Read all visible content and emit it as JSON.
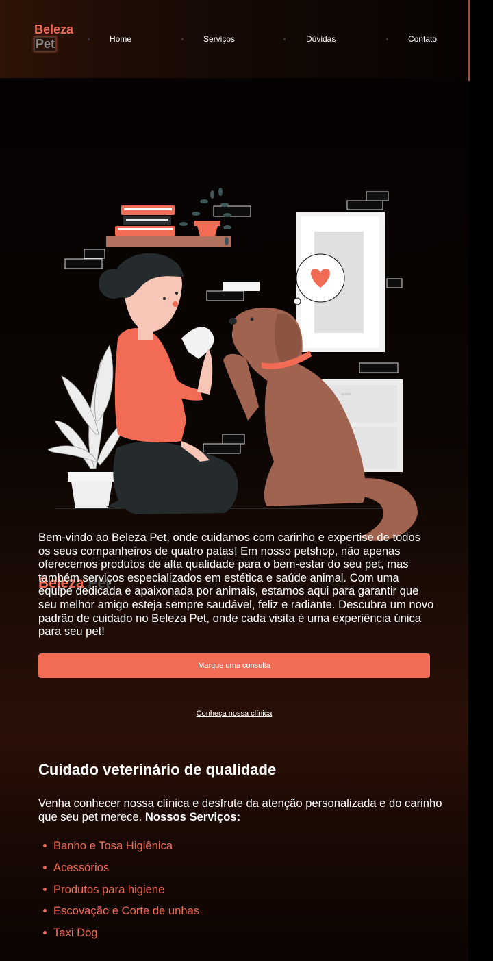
{
  "header": {
    "logo_line1": "Beleza",
    "logo_line2": "Pet",
    "nav": [
      "Home",
      "Serviços",
      "Dúvidas",
      "Contato"
    ]
  },
  "hero": {
    "title_part1": "Beleza",
    "title_part2": "Pet",
    "intro": "Bem-vindo ao Beleza Pet, onde cuidamos com carinho e expertise de todos os seus companheiros de quatro patas! Em nosso petshop, não apenas oferecemos produtos de alta qualidade para o bem-estar do seu pet, mas também serviços especializados em estética e saúde animal. Com uma equipe dedicada e apaixonada por animais, estamos aqui para garantir que seu melhor amigo esteja sempre saudável, feliz e radiante. Descubra um novo padrão de cuidado no Beleza Pet, onde cada visita é uma experiência única para seu pet!",
    "cta_label": "Marque uma consulta",
    "link_label": "Conheça nossa clínica"
  },
  "services": {
    "title": "Cuidado veterinário de qualidade",
    "text": "Venha conhecer nossa clínica e desfrute da atenção personalizada e do carinho que seu pet merece.",
    "text_bold": "Nossos Serviços:",
    "items": [
      "Banho e Tosa Higiênica",
      "Acessórios",
      "Produtos para higiene",
      "Escovação e Corte de unhas",
      "Taxi Dog"
    ]
  },
  "colors": {
    "accent": "#f26b55",
    "dark_gray": "#45494c",
    "dog_brown": "#a0634f"
  },
  "icons": {
    "illustration": "woman-and-dog-high-five-illustration",
    "heart": "heart-icon"
  }
}
